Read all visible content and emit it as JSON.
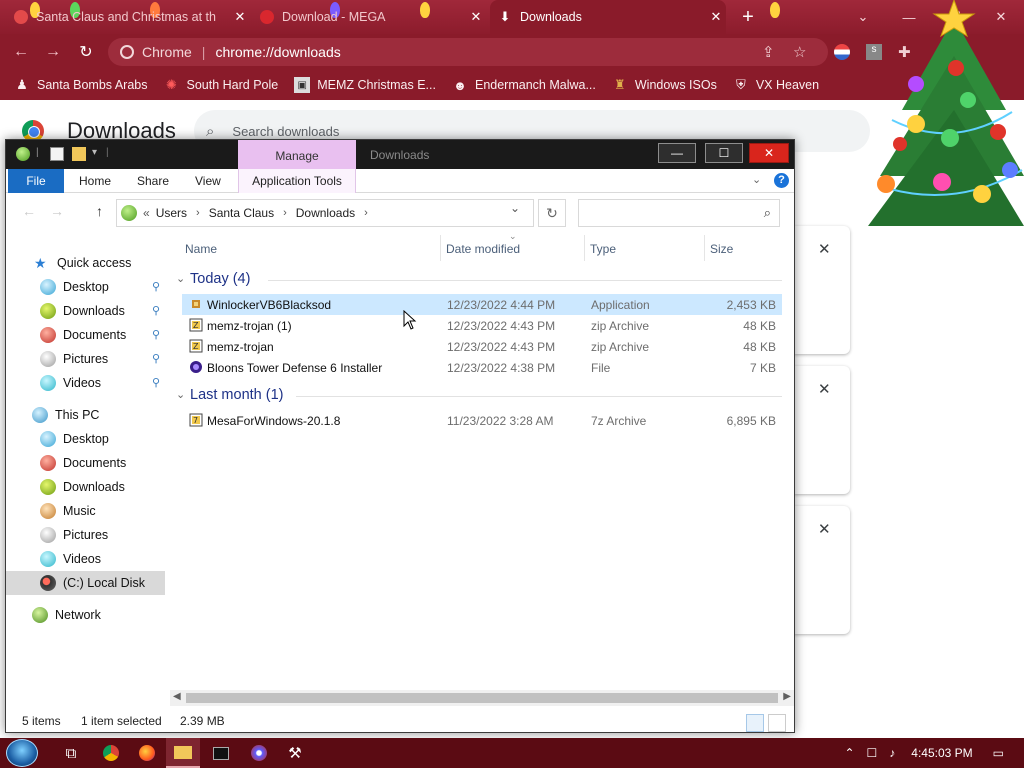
{
  "browser": {
    "tabs": [
      {
        "title": "Santa Claus and Christmas at th",
        "close": "✕"
      },
      {
        "title": "Download - MEGA",
        "close": "✕"
      },
      {
        "title": "Downloads",
        "close": "✕",
        "active": true
      }
    ],
    "new_tab": "+",
    "window_controls": {
      "list": "⌄",
      "minimize": "—",
      "maximize": "☐",
      "close": "✕"
    },
    "omnibox": {
      "site_name": "Chrome",
      "url": "chrome://downloads"
    },
    "bookmarks": [
      {
        "label": "Santa Bombs Arabs",
        "icon": "santa-icon"
      },
      {
        "label": "South Hard Pole",
        "icon": "snowflake-icon"
      },
      {
        "label": "MEMZ Christmas E...",
        "icon": "memz-icon"
      },
      {
        "label": "Endermanch Malwa...",
        "icon": "raccoon-icon"
      },
      {
        "label": "Windows ISOs",
        "icon": "figure-icon"
      },
      {
        "label": "VX Heaven",
        "icon": "shield-icon"
      }
    ],
    "accent": "#8a1b2a"
  },
  "downloads_page": {
    "title": "Downloads",
    "search_placeholder": "Search downloads",
    "card_close": "✕"
  },
  "explorer": {
    "window_title": "Downloads",
    "manage_label": "Manage",
    "ribbon_tabs": [
      "File",
      "Home",
      "Share",
      "View",
      "Application Tools"
    ],
    "help": "?",
    "breadcrumb": {
      "overflow": "«",
      "parts": [
        "Users",
        "Santa Claus",
        "Downloads"
      ]
    },
    "nav_pane": {
      "quick_access": "Quick access",
      "quick_items": [
        "Desktop",
        "Downloads",
        "Documents",
        "Pictures",
        "Videos"
      ],
      "this_pc": "This PC",
      "pc_items": [
        "Desktop",
        "Documents",
        "Downloads",
        "Music",
        "Pictures",
        "Videos",
        "(C:) Local Disk"
      ],
      "network": "Network"
    },
    "columns": [
      "Name",
      "Date modified",
      "Type",
      "Size"
    ],
    "groups": [
      {
        "label": "Today (4)",
        "files": [
          {
            "name": "WinlockerVB6Blacksod",
            "date": "12/23/2022 4:44 PM",
            "type": "Application",
            "size": "2,453 KB",
            "icon": "application-icon",
            "selected": true
          },
          {
            "name": "memz-trojan (1)",
            "date": "12/23/2022 4:43 PM",
            "type": "zip Archive",
            "size": "48 KB",
            "icon": "zip-icon"
          },
          {
            "name": "memz-trojan",
            "date": "12/23/2022 4:43 PM",
            "type": "zip Archive",
            "size": "48 KB",
            "icon": "zip-icon"
          },
          {
            "name": "Bloons Tower Defense 6 Installer",
            "date": "12/23/2022 4:38 PM",
            "type": "File",
            "size": "7 KB",
            "icon": "bloons-icon"
          }
        ]
      },
      {
        "label": "Last month (1)",
        "files": [
          {
            "name": "MesaForWindows-20.1.8",
            "date": "11/23/2022 3:28 AM",
            "type": "7z Archive",
            "size": "6,895 KB",
            "icon": "archive-icon"
          }
        ]
      }
    ],
    "status": {
      "count": "5 items",
      "selected": "1 item selected",
      "size": "2.39 MB"
    }
  },
  "taskbar": {
    "time": "4:45:03 PM",
    "apps": [
      "task-view-icon",
      "chrome-icon",
      "firefox-icon",
      "explorer-icon",
      "cmd-icon",
      "hypercam-icon",
      "network-tool-icon"
    ]
  }
}
